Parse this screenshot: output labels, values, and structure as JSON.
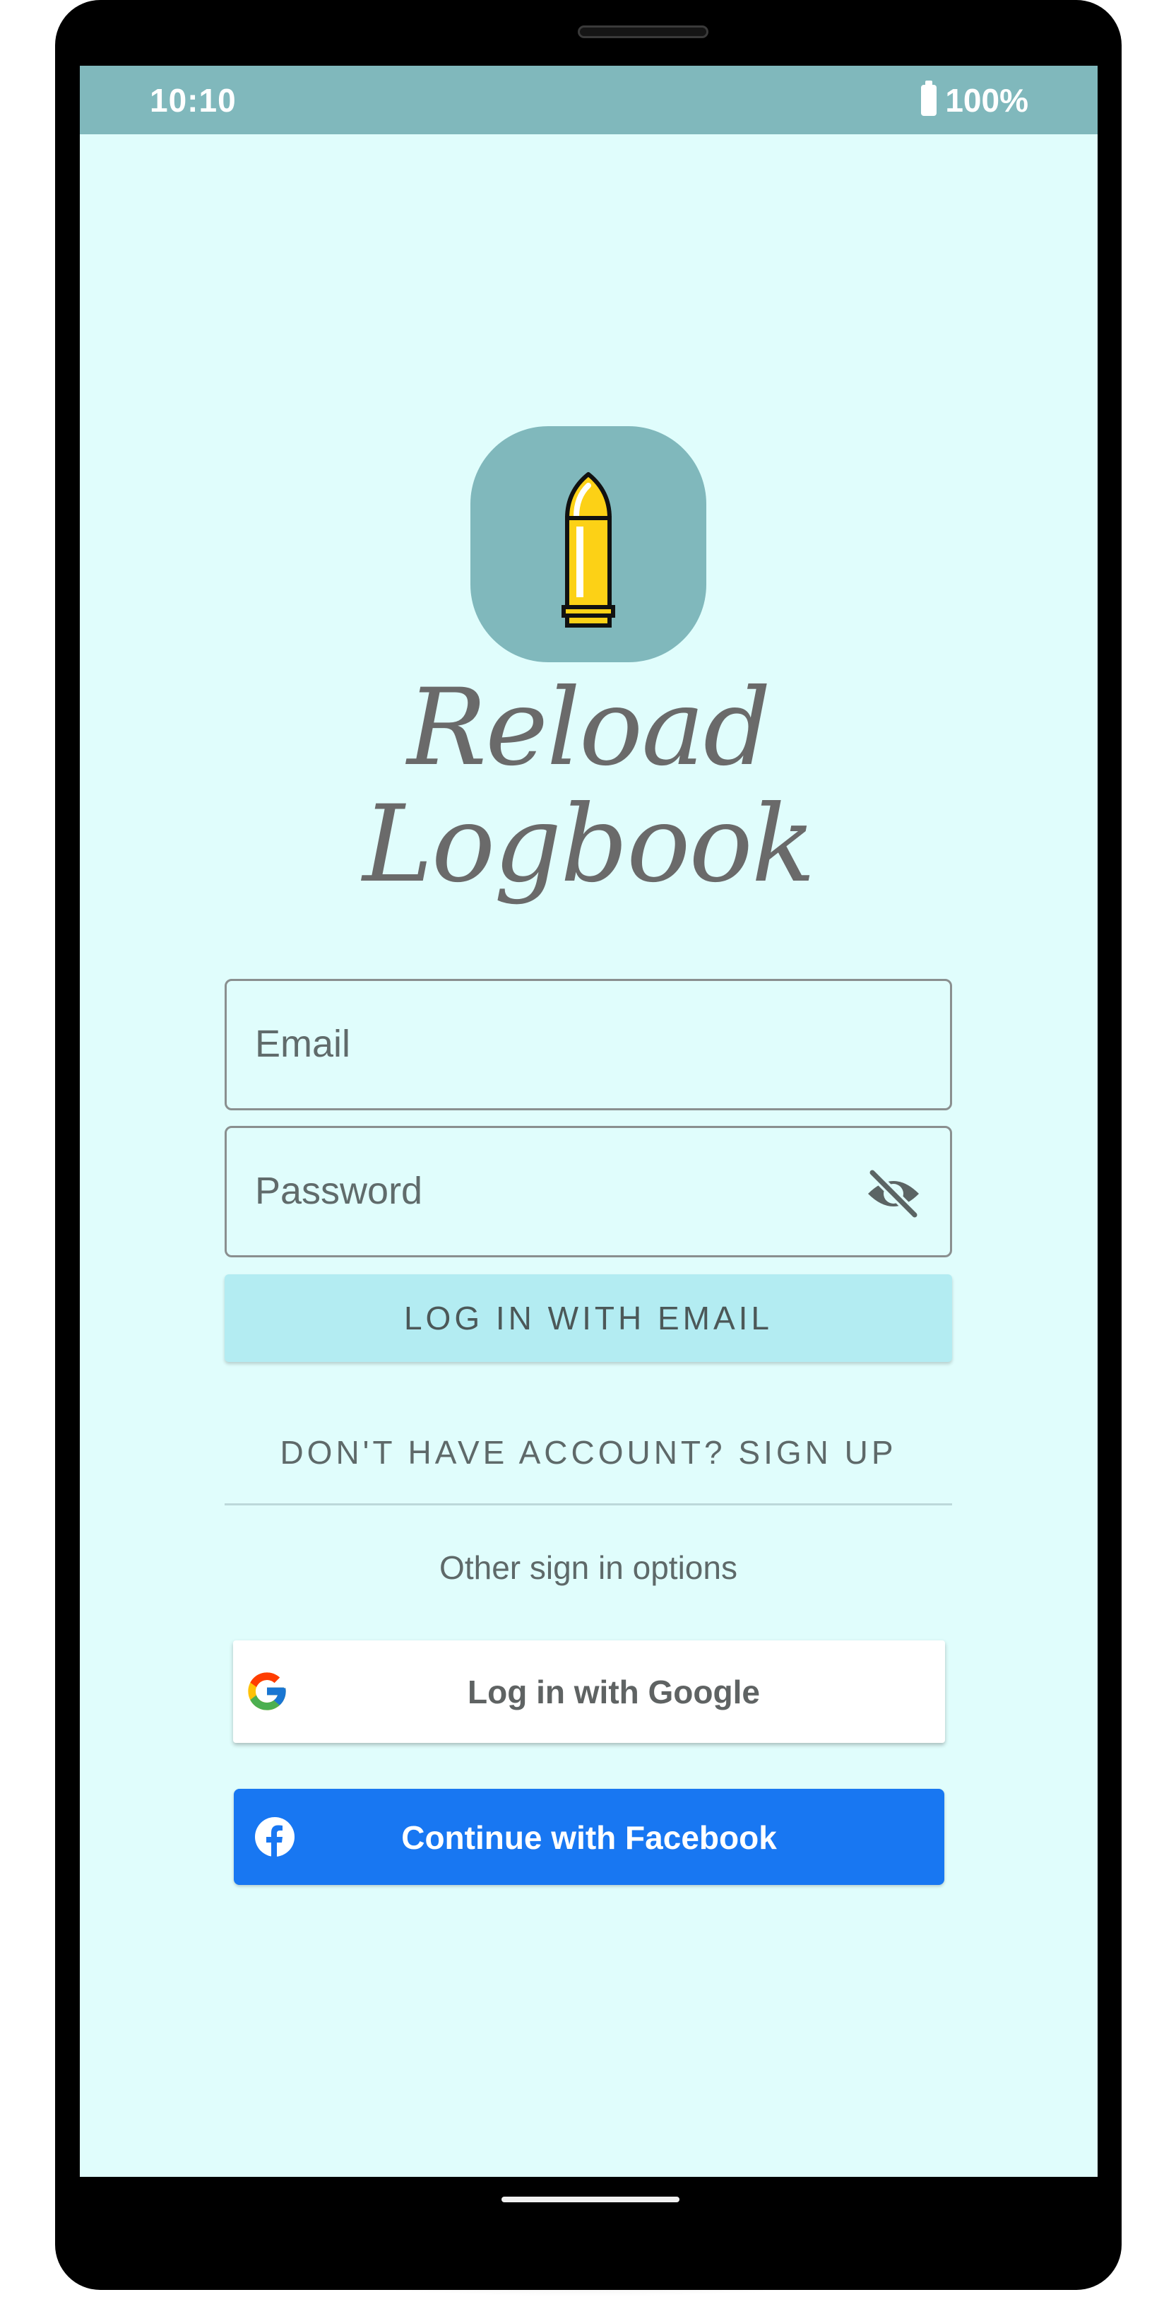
{
  "status_bar": {
    "time": "10:10",
    "battery": "100%"
  },
  "app": {
    "title": "Reload Logbook"
  },
  "form": {
    "email_placeholder": "Email",
    "password_placeholder": "Password",
    "login_email_label": "LOG IN WITH EMAIL",
    "signup_label": "DON'T HAVE ACCOUNT? SIGN UP",
    "other_options_label": "Other sign in options",
    "google_label": "Log in with Google",
    "facebook_label": "Continue with Facebook"
  },
  "colors": {
    "status_bar": "#80b8bc",
    "screen_background": "#e0fdfc",
    "email_button": "#b3ecf2",
    "facebook_blue": "#1877f2"
  },
  "icons": [
    "battery-icon",
    "bullet-logo-icon",
    "eye-off-icon",
    "google-icon",
    "facebook-icon"
  ]
}
